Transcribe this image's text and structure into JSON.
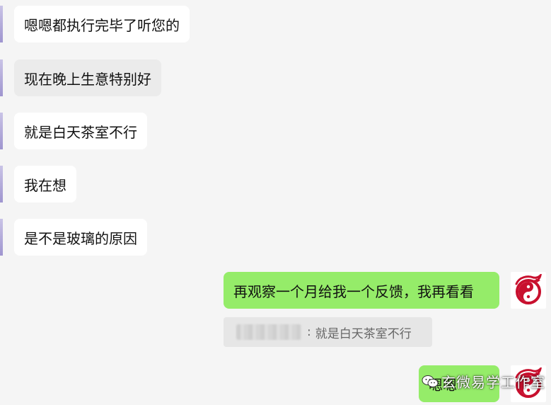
{
  "messages_in": [
    {
      "text": "嗯嗯都执行完毕了听您的"
    },
    {
      "text": "现在晚上生意特别好"
    },
    {
      "text": "就是白天茶室不行"
    },
    {
      "text": "我在想"
    },
    {
      "text": "是不是玻璃的原因"
    }
  ],
  "messages_out": [
    {
      "text": "再观察一个月给我一个反馈，我再看看"
    },
    {
      "text": "嗯嗯"
    }
  ],
  "quote": {
    "separator": ":",
    "text": "就是白天茶室不行"
  },
  "watermark": {
    "text": "玄微易学工作室",
    "icon": "wechat-icon"
  },
  "avatar": {
    "icon": "dragon-taiji-logo",
    "color": "#c8102e"
  },
  "colors": {
    "background": "#f5f5f5",
    "incoming_bubble": "#ffffff",
    "outgoing_bubble": "#95ec69",
    "quote_bg": "#e6e6e6"
  }
}
